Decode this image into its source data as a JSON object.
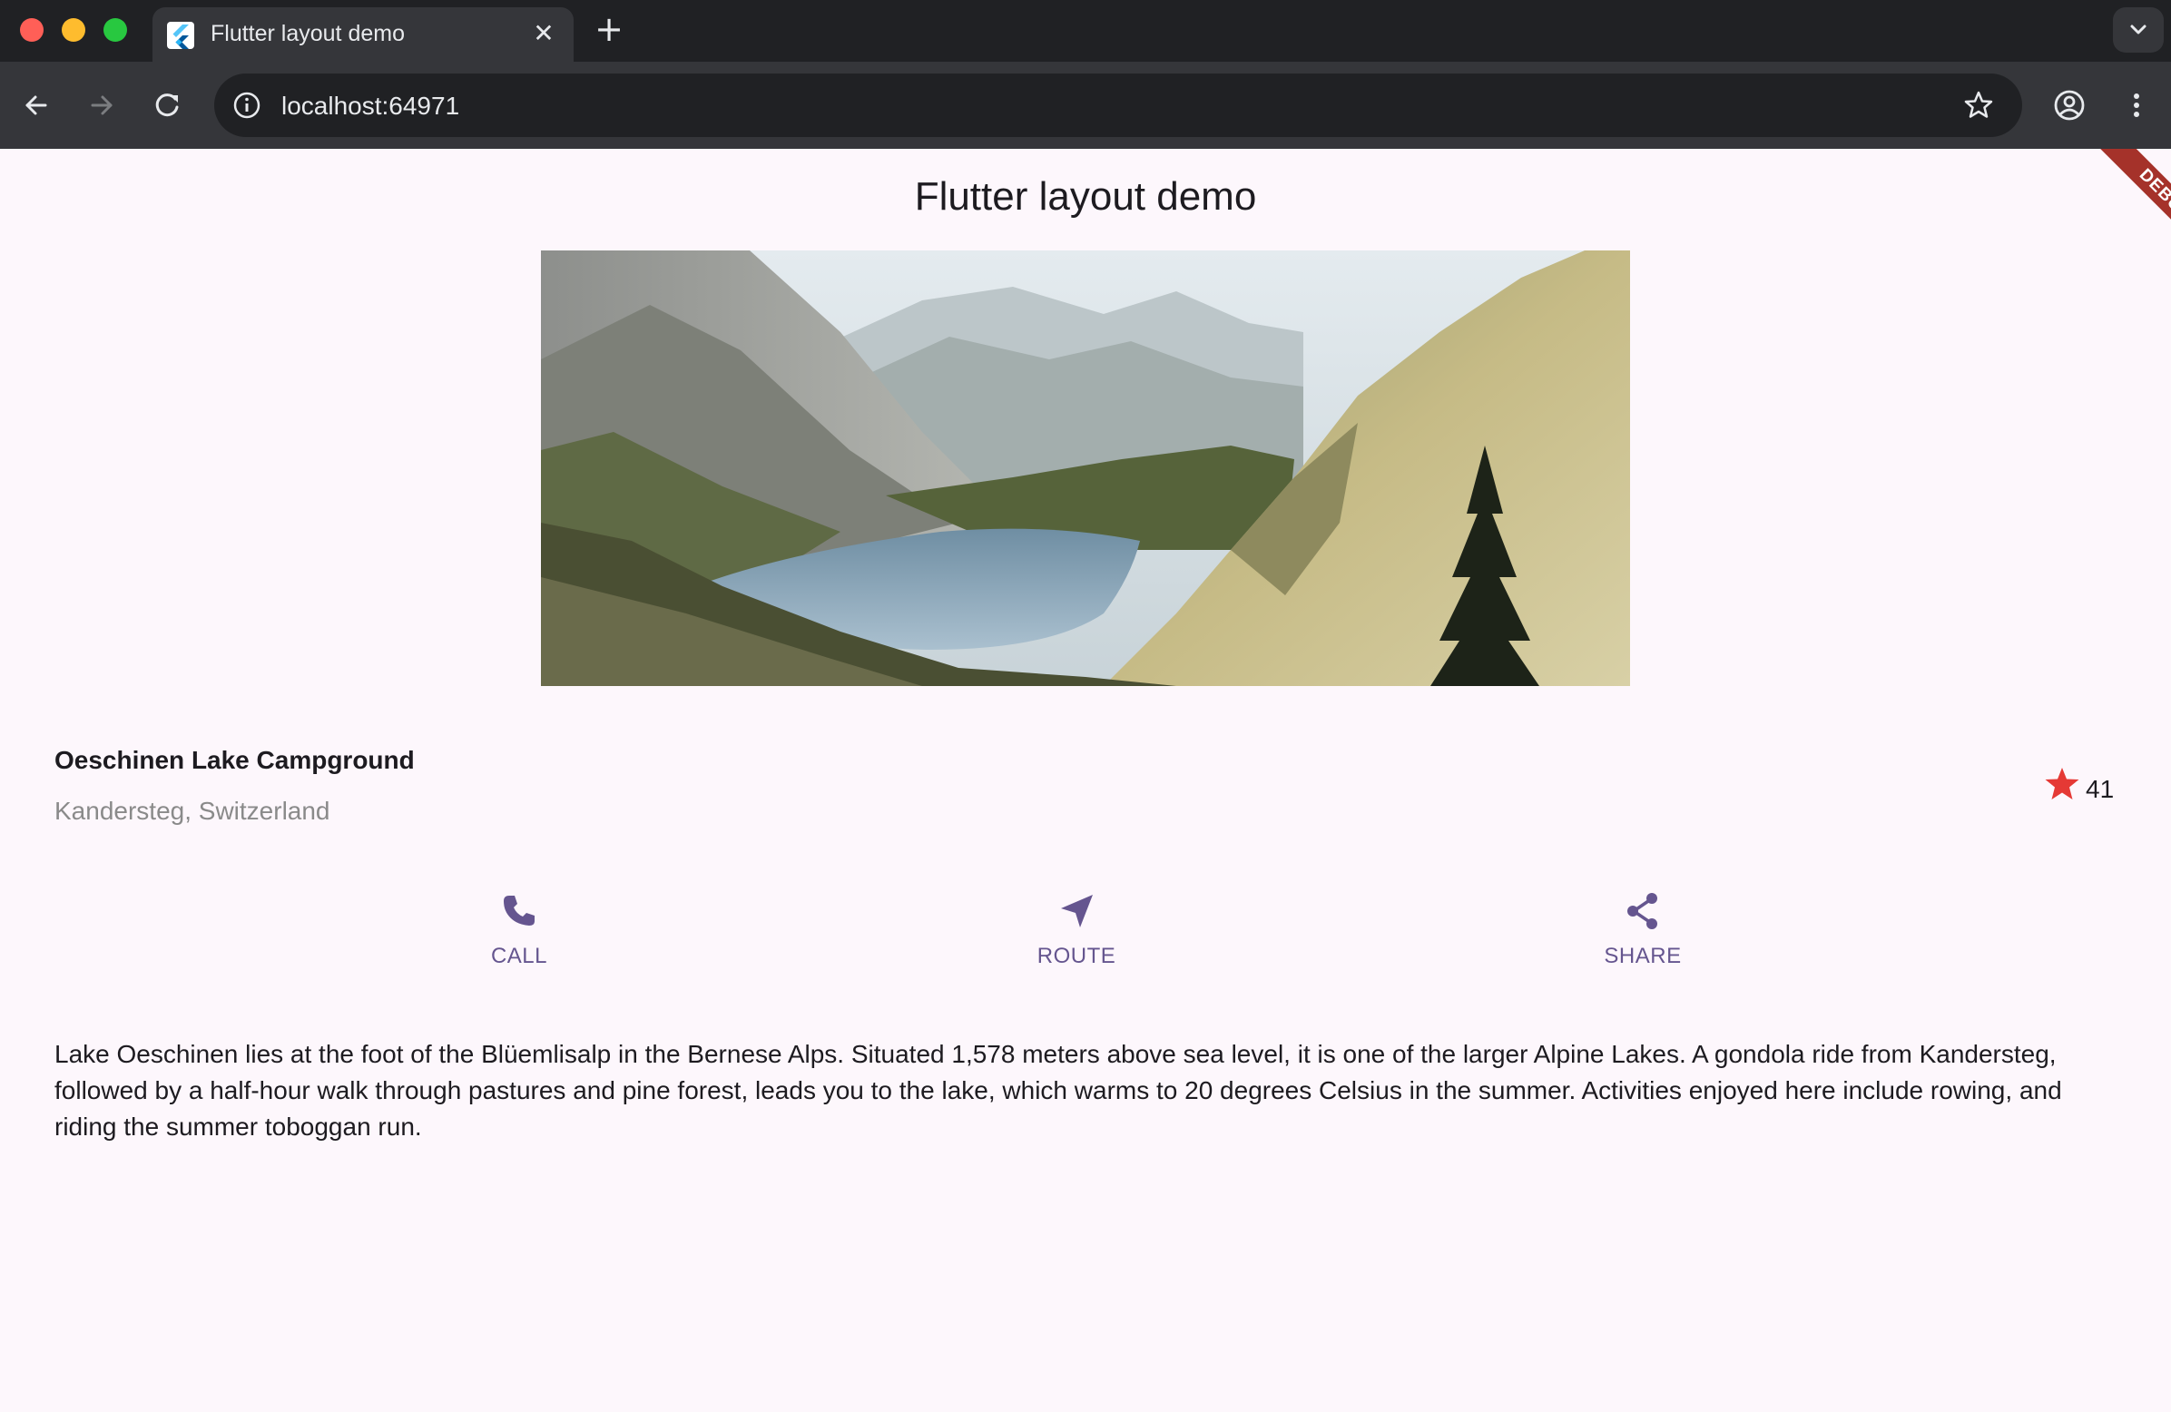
{
  "browser": {
    "tab_title": "Flutter layout demo",
    "url": "localhost:64971"
  },
  "app": {
    "title": "Flutter layout demo",
    "debug_banner": "DEBUG",
    "place": {
      "name": "Oeschinen Lake Campground",
      "location": "Kandersteg, Switzerland",
      "rating": "41",
      "rating_icon": "star-icon"
    },
    "actions": [
      {
        "label": "CALL",
        "icon": "phone-icon"
      },
      {
        "label": "ROUTE",
        "icon": "navigation-icon"
      },
      {
        "label": "SHARE",
        "icon": "share-icon"
      }
    ],
    "description": "Lake Oeschinen lies at the foot of the Blüemlisalp in the Bernese Alps. Situated 1,578 meters above sea level, it is one of the larger Alpine Lakes. A gondola ride from Kandersteg, followed by a half-hour walk through pastures and pine forest, leads you to the lake, which warms to 20 degrees Celsius in the summer. Activities enjoyed here include rowing, and riding the summer toboggan run."
  },
  "colors": {
    "primary": "#65558f",
    "star": "#e53935",
    "background": "#fdf7fc",
    "secondary_text": "#8a8a8a"
  }
}
